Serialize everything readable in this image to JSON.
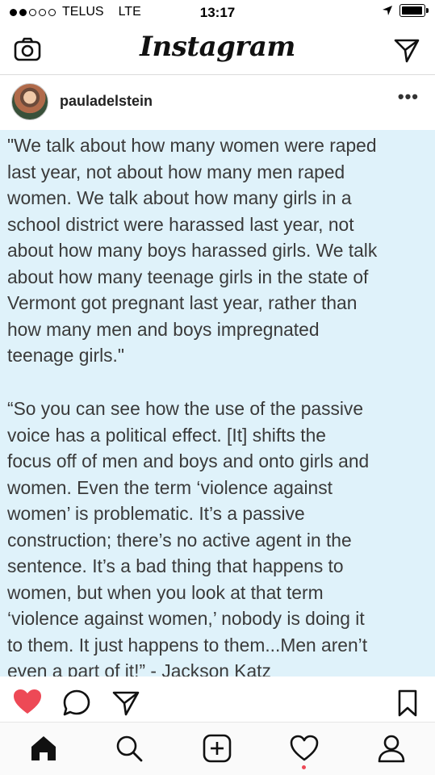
{
  "status_bar": {
    "carrier": "TELUS",
    "network": "LTE",
    "time": "13:17",
    "signal_bars_filled": 2,
    "signal_bars_total": 5
  },
  "header": {
    "title": "Instagram",
    "left_icon": "camera-icon",
    "right_icon": "direct-message-icon"
  },
  "post": {
    "username": "pauladelstein",
    "more_label": "•••",
    "quote_paragraph_1": "\"We talk about how many women were raped\nlast year, not about how many men raped\nwomen. We talk about how many girls in a\nschool district were harassed last year, not\nabout how many boys harassed girls. We talk\nabout how many teenage girls in the state of\nVermont got pregnant last year, rather than\nhow many men and boys impregnated\nteenage girls.\"",
    "quote_paragraph_2": "“So you can see how the use of the passive\nvoice has a political effect. [It] shifts the\nfocus off of men and boys and onto girls and\nwomen. Even the term ‘violence against\nwomen’ is problematic. It’s a passive\nconstruction; there’s no active agent in the\nsentence. It’s a bad thing that happens to\nwomen, but when you look at that term\n‘violence against women,’ nobody is doing it\nto them. It just happens to them...Men aren’t\neven a part of it!” - Jackson Katz",
    "liked": true
  },
  "actions": [
    "like-icon",
    "comment-icon",
    "share-icon",
    "bookmark-icon"
  ],
  "bottom_nav": [
    "home-icon",
    "search-icon",
    "add-post-icon",
    "activity-icon",
    "profile-icon"
  ],
  "colors": {
    "like": "#ed4956",
    "post_background": "#dff2fa",
    "quote_text": "#3a3a3a"
  }
}
